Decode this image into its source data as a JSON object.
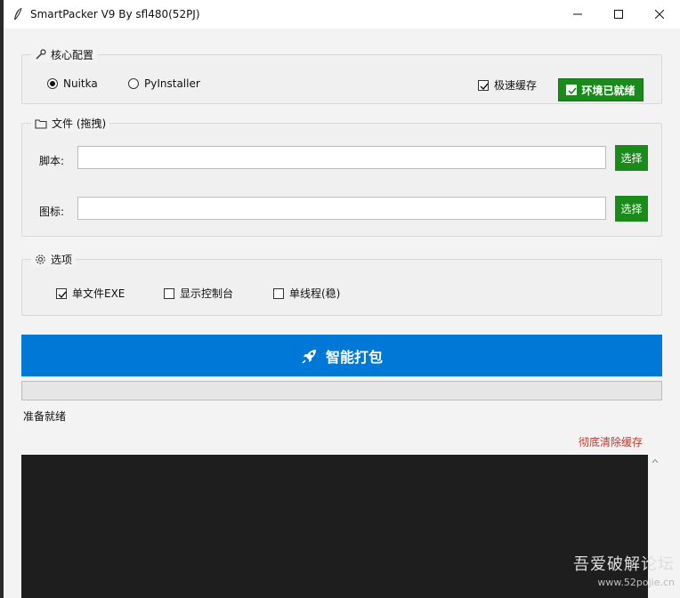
{
  "window": {
    "title": "SmartPacker V9 By sfl480(52PJ)"
  },
  "core_config": {
    "legend": "核心配置",
    "radios": [
      {
        "label": "Nuitka",
        "selected": true
      },
      {
        "label": "PyInstaller",
        "selected": false
      }
    ],
    "fast_cache": {
      "label": "极速缓存",
      "checked": true
    },
    "env_badge": "环境已就绪"
  },
  "files": {
    "legend": "文件 (拖拽)",
    "script_label": "脚本:",
    "script_value": "",
    "icon_label": "图标:",
    "icon_value": "",
    "pick_label": "选择"
  },
  "options": {
    "legend": "选项",
    "items": [
      {
        "label": "单文件EXE",
        "checked": true
      },
      {
        "label": "显示控制台",
        "checked": false
      },
      {
        "label": "单线程(稳)",
        "checked": false
      }
    ]
  },
  "actions": {
    "pack_label": "智能打包",
    "progress": 0,
    "status": "准备就绪",
    "clear_cache": "彻底清除缓存"
  },
  "watermark": {
    "main": "吾爱破解论坛",
    "sub": "www.52pojie.cn"
  },
  "colors": {
    "primary": "#0078d7",
    "success": "#1a8a1a",
    "danger": "#c0392b",
    "console_bg": "#1e1e1e"
  },
  "icons": {
    "app": "feather-icon",
    "core_config": "wrench-icon",
    "files": "folder-icon",
    "options": "gear-icon",
    "pack": "rocket-icon"
  }
}
